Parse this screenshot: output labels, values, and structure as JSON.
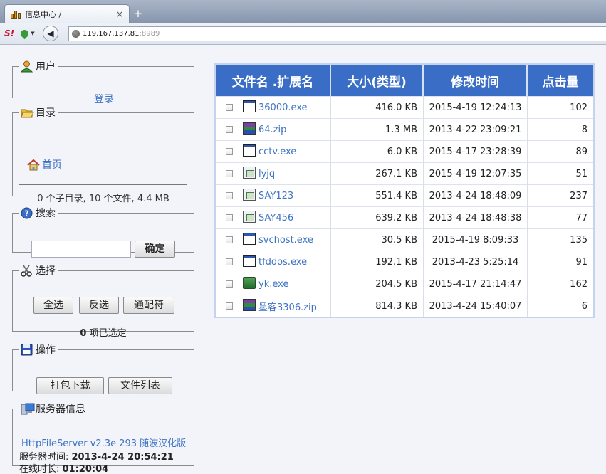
{
  "browser": {
    "tab_title": "信息中心 /",
    "tab_close": "×",
    "new_tab": "+",
    "brand_label": "S!",
    "address_host": "119.167.137.81",
    "address_port": ":8989"
  },
  "panels": {
    "user": {
      "legend": "用户",
      "login_link": "登录"
    },
    "dir": {
      "legend": "目录",
      "home_link": "首页",
      "stats": "0 个子目录, 10 个文件, 4.4 MB"
    },
    "search": {
      "legend": "搜索",
      "input_value": "",
      "button": "确定"
    },
    "select": {
      "legend": "选择",
      "select_all": "全选",
      "invert": "反选",
      "wildcard": "通配符",
      "count": "0",
      "count_suffix": " 项已选定"
    },
    "ops": {
      "legend": "操作",
      "zip": "打包下载",
      "file_list": "文件列表"
    },
    "server": {
      "legend": "服务器信息",
      "name": "HttpFileServer v2.3e 293 随波汉化版",
      "time_label": "服务器时间: ",
      "time_value": "2013-4-24 20:54:21",
      "uptime_label": "在线时长: ",
      "uptime_value": "01:20:04"
    }
  },
  "table": {
    "headers": {
      "name": "文件名 .扩展名",
      "size": "大小(类型)",
      "modified": "修改时间",
      "hits": "点击量"
    },
    "rows": [
      {
        "name": "36000.exe",
        "icon": "exe",
        "size": "416.0 KB",
        "modified": "2015-4-19 12:24:13",
        "hits": "102"
      },
      {
        "name": "64.zip",
        "icon": "zip",
        "size": "1.3 MB",
        "modified": "2013-4-22 23:09:21",
        "hits": "8"
      },
      {
        "name": "cctv.exe",
        "icon": "exe",
        "size": "6.0 KB",
        "modified": "2015-4-17 23:28:39",
        "hits": "89"
      },
      {
        "name": "lyjq",
        "icon": "doc",
        "size": "267.1 KB",
        "modified": "2015-4-19 12:07:35",
        "hits": "51"
      },
      {
        "name": "SAY123",
        "icon": "doc",
        "size": "551.4 KB",
        "modified": "2013-4-24 18:48:09",
        "hits": "237"
      },
      {
        "name": "SAY456",
        "icon": "doc",
        "size": "639.2 KB",
        "modified": "2013-4-24 18:48:38",
        "hits": "77"
      },
      {
        "name": "svchost.exe",
        "icon": "exe",
        "size": "30.5 KB",
        "modified": "2015-4-19 8:09:33",
        "hits": "135"
      },
      {
        "name": "tfddos.exe",
        "icon": "exe",
        "size": "192.1 KB",
        "modified": "2013-4-23 5:25:14",
        "hits": "91"
      },
      {
        "name": "yk.exe",
        "icon": "app",
        "size": "204.5 KB",
        "modified": "2015-4-17 21:14:47",
        "hits": "162"
      },
      {
        "name": "墨客3306.zip",
        "icon": "zip",
        "size": "814.3 KB",
        "modified": "2013-4-24 15:40:07",
        "hits": "6"
      }
    ]
  },
  "colors": {
    "header_bg": "#3a6ec6",
    "link": "#3d73c4",
    "page_bg": "#f3f4fa"
  }
}
